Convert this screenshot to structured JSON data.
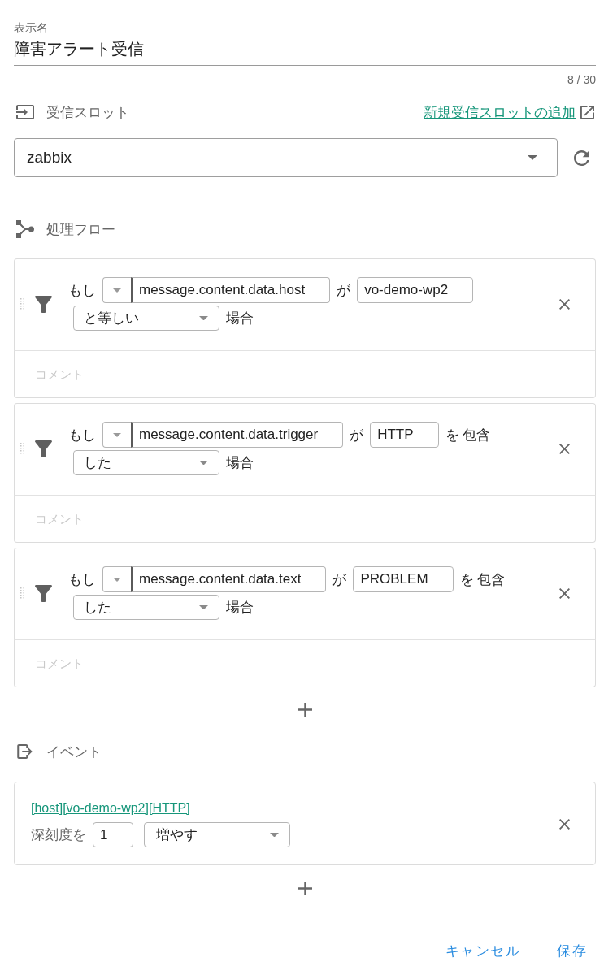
{
  "display_name": {
    "label": "表示名",
    "value": "障害アラート受信",
    "counter": "8 / 30"
  },
  "receive_slot": {
    "title": "受信スロット",
    "add_link": "新規受信スロットの追加",
    "value": "zabbix"
  },
  "flow": {
    "title": "処理フロー",
    "filters": [
      {
        "if": "もし",
        "field": "message.content.data.host",
        "particle": "が",
        "value": "vo-demo-wp2",
        "operator": "と等しい",
        "case": "場合",
        "comment_placeholder": "コメント"
      },
      {
        "if": "もし",
        "field": "message.content.data.trigger",
        "particle": "が",
        "value": "HTTP",
        "object": "を 包含",
        "operator": "した",
        "case": "場合",
        "comment_placeholder": "コメント"
      },
      {
        "if": "もし",
        "field": "message.content.data.text",
        "particle": "が",
        "value": "PROBLEM",
        "object": "を 包含",
        "operator": "した",
        "case": "場合",
        "comment_placeholder": "コメント"
      }
    ]
  },
  "event": {
    "title": "イベント",
    "actions": [
      {
        "link": "[host][vo-demo-wp2][HTTP]",
        "label": "深刻度を",
        "amount": "1",
        "operation": "増やす"
      }
    ]
  },
  "buttons": [
    {
      "label": "キャンセル"
    },
    {
      "label": "保存"
    }
  ]
}
